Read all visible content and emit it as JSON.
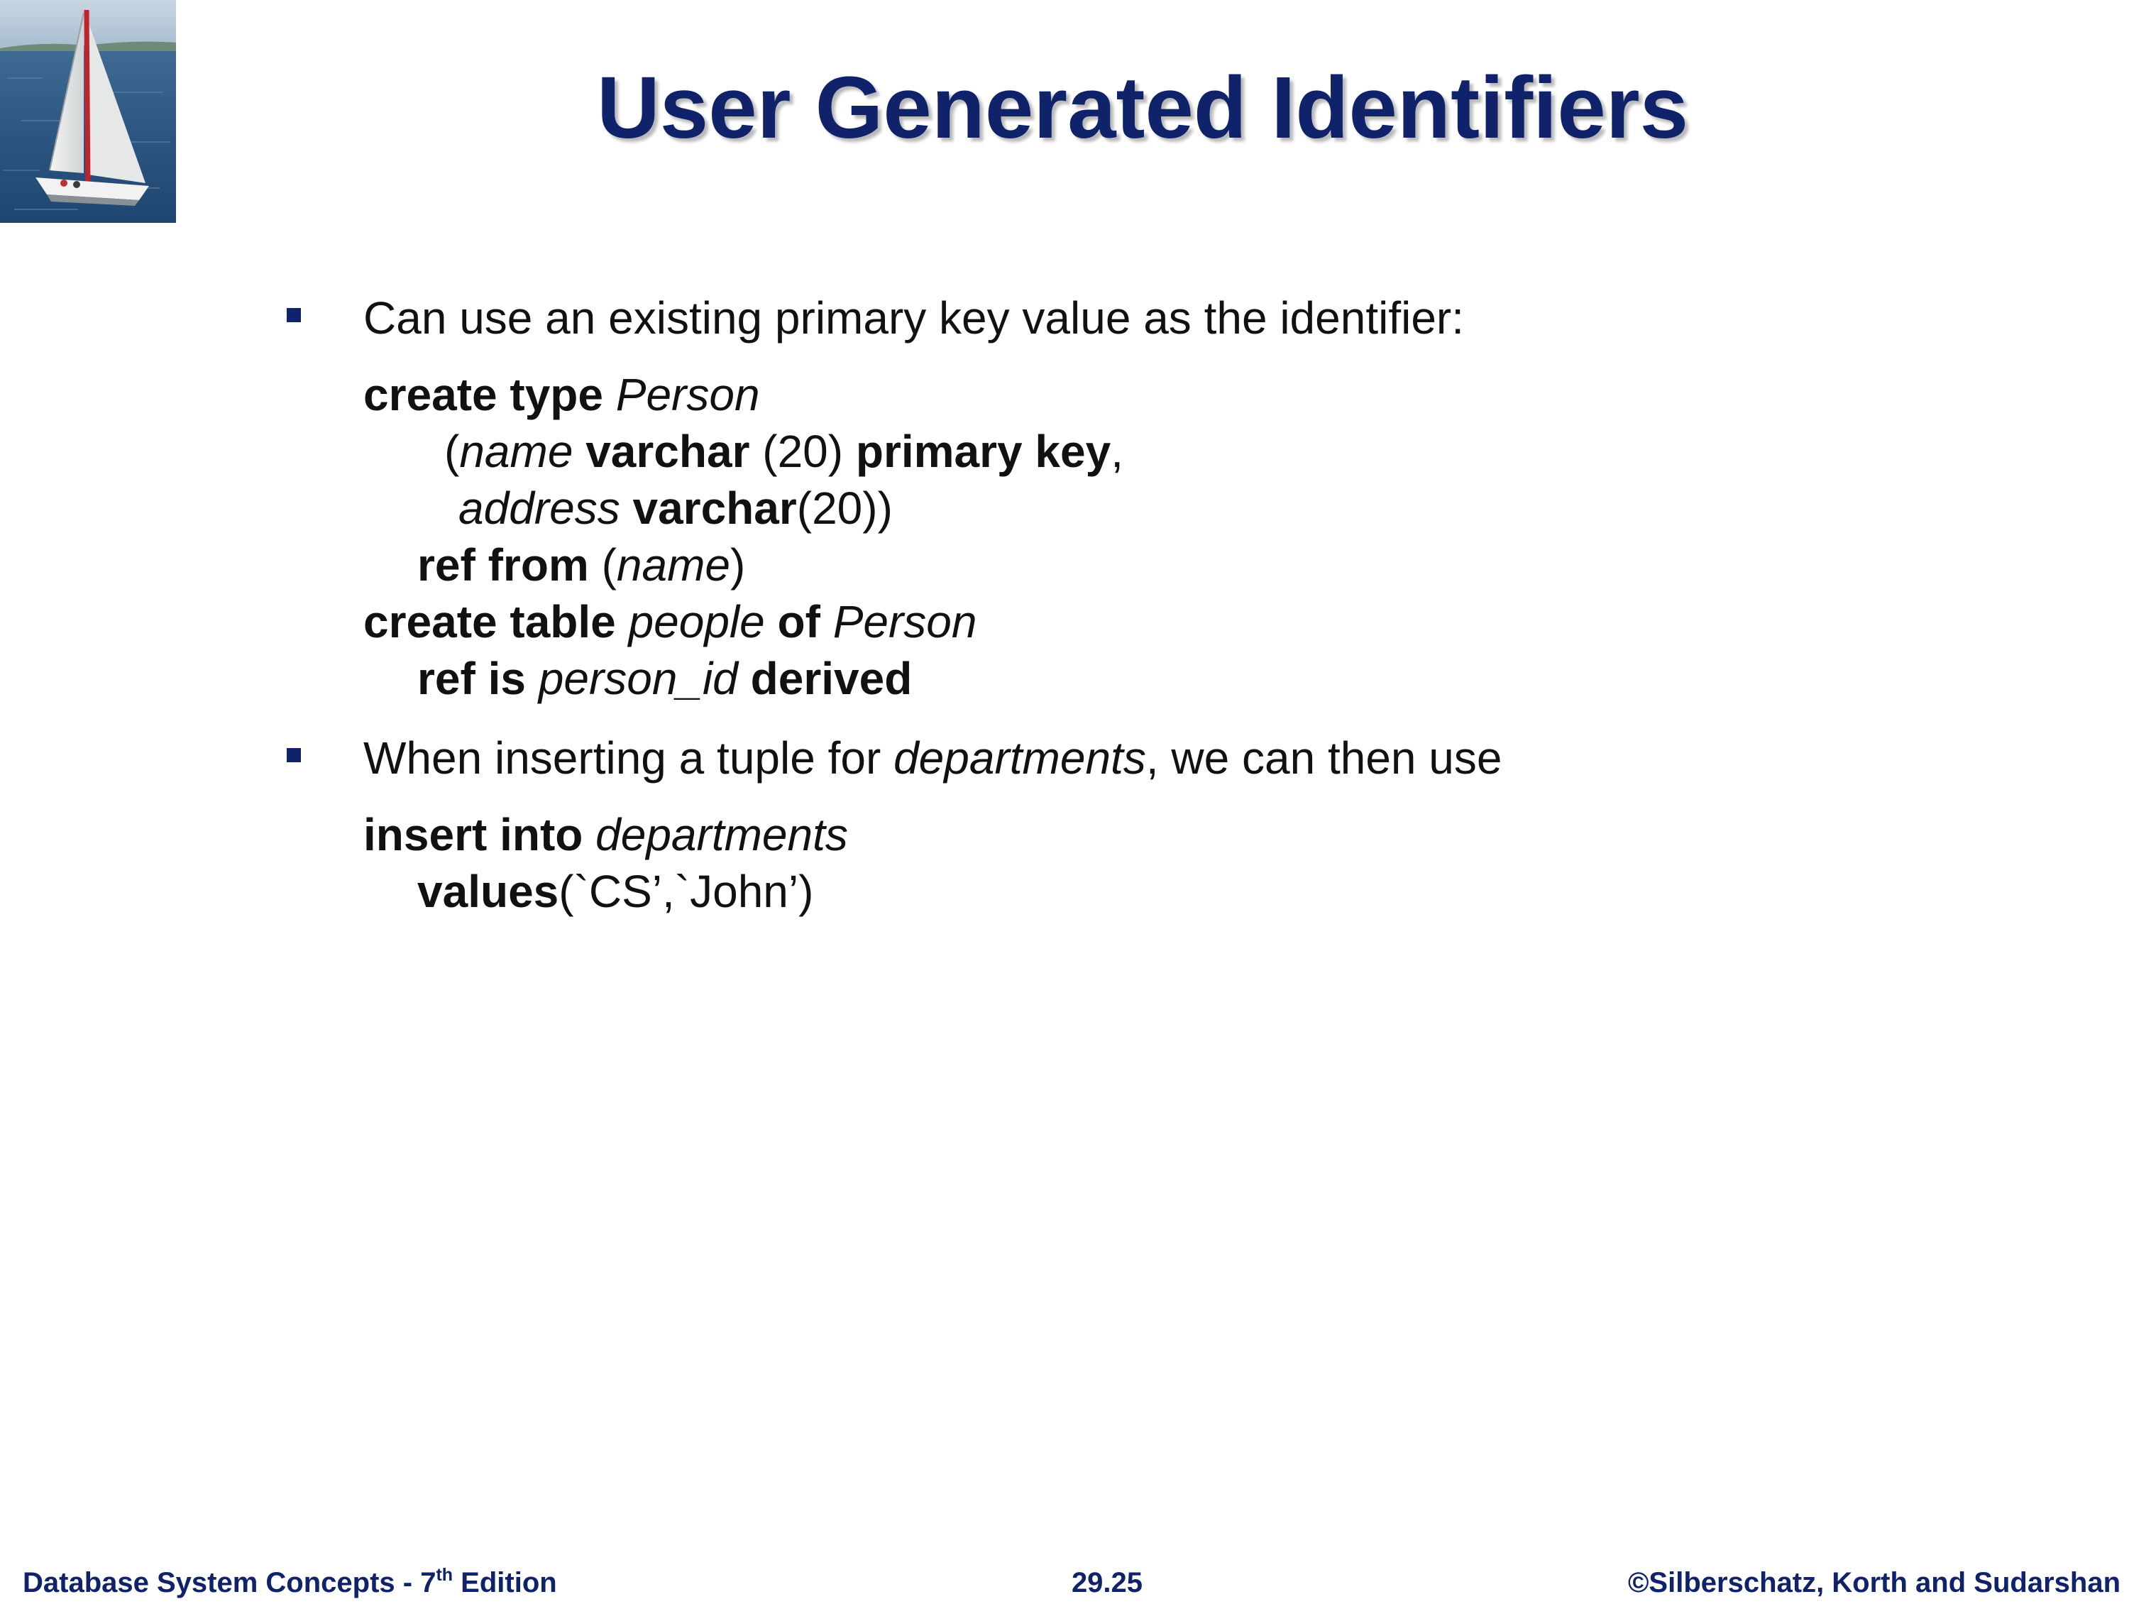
{
  "slide": {
    "title": "User Generated Identifiers"
  },
  "bullets": [
    {
      "text": "Can use an existing primary key value as the identifier:"
    },
    {
      "pre": "When inserting a tuple for ",
      "em": "departments",
      "post": ", we can then use"
    }
  ],
  "code1": {
    "l1_kw": "create type",
    "l1_id": "Person",
    "l2_open": "(",
    "l2_id": "name",
    "l2_kw1": "varchar",
    "l2_len": "(20)",
    "l2_kw2": "primary key",
    "l2_comma": ",",
    "l3_id": "address",
    "l3_kw": "varchar",
    "l3_len": "(20))",
    "l4_kw": "ref from",
    "l4_open": "(",
    "l4_id": "name",
    "l4_close": ")",
    "l5_kw1": "create table",
    "l5_id1": "people",
    "l5_kw2": "of",
    "l5_id2": "Person",
    "l6_kw1": "ref is",
    "l6_id": "person_id",
    "l6_kw2": "derived"
  },
  "code2": {
    "l1_kw": "insert into",
    "l1_id": "departments",
    "l2_kw": "values",
    "l2_args": "(`CS’,`John’)"
  },
  "footer": {
    "left_main": "Database System Concepts - 7",
    "left_sup": "th",
    "left_tail": " Edition",
    "center": "29.25",
    "right": "©Silberschatz, Korth and Sudarshan"
  },
  "colors": {
    "title": "#10226a",
    "bullet": "#10226a",
    "footer": "#10226a",
    "text": "#111111"
  },
  "icons": {
    "logo": "sailboat-image",
    "bullet": "square-bullet-icon"
  }
}
